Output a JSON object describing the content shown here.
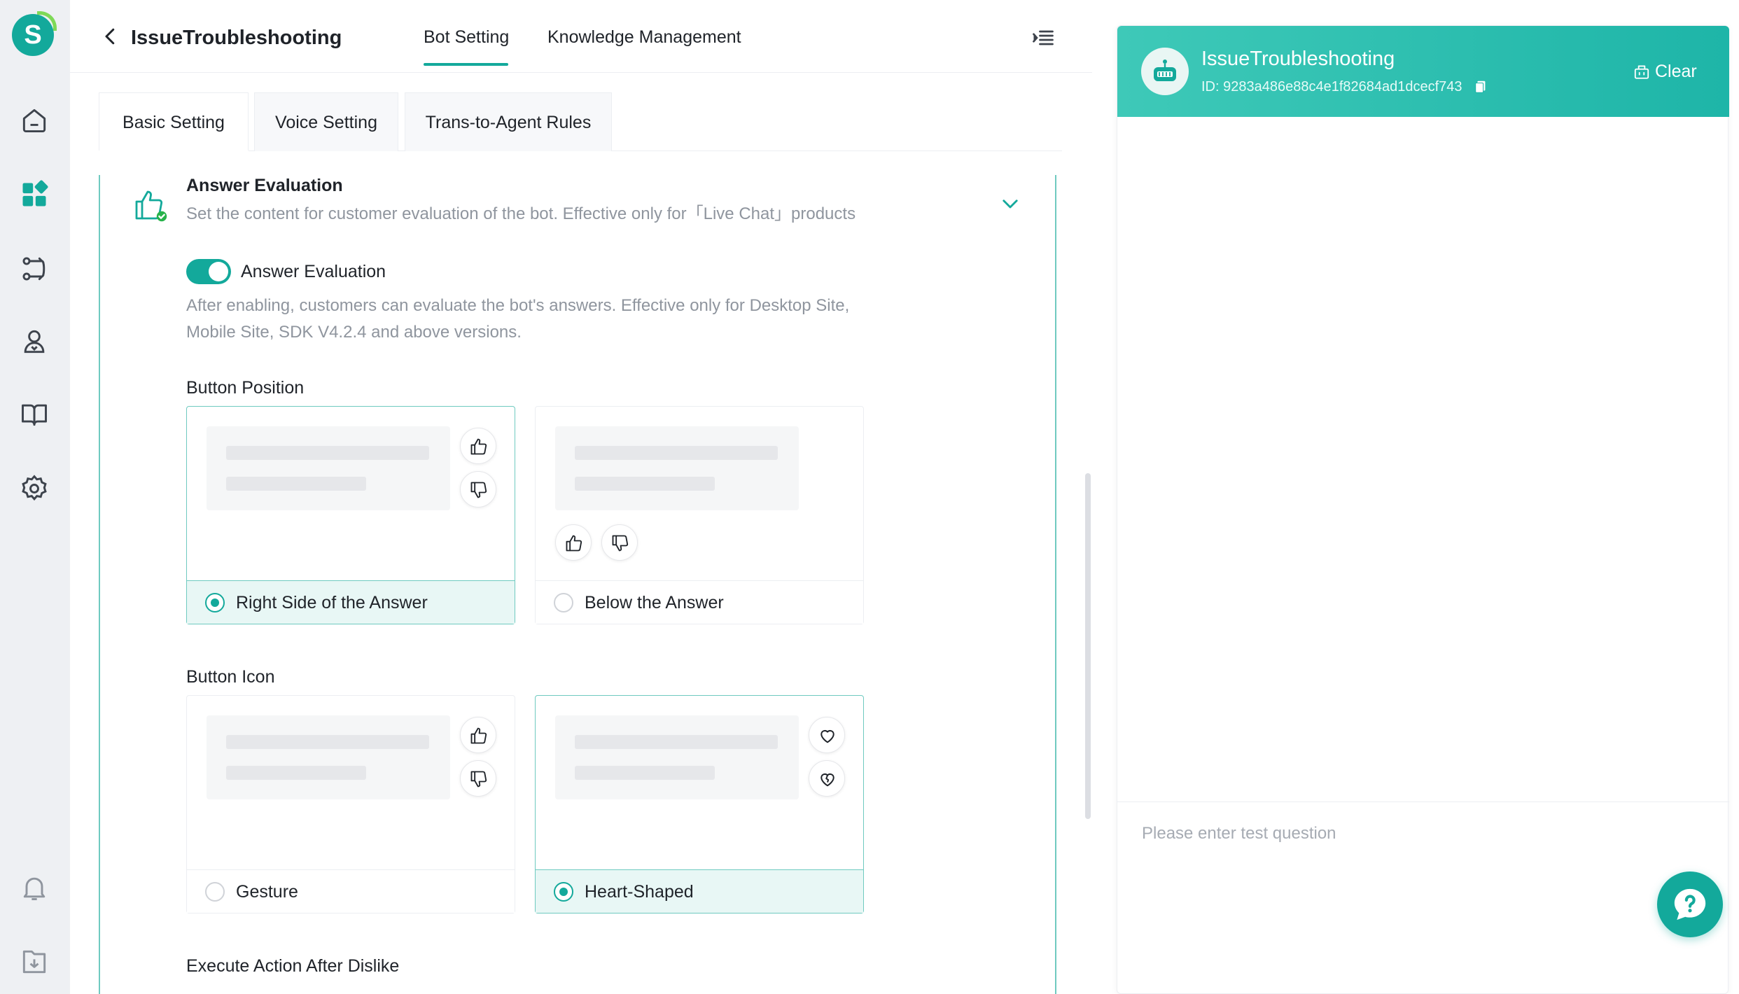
{
  "header": {
    "bot_name": "IssueTroubleshooting",
    "tabs": [
      {
        "label": "Bot Setting",
        "active": true
      },
      {
        "label": "Knowledge Management",
        "active": false
      }
    ]
  },
  "sidebar": {
    "logo_letter": "S",
    "items": [
      {
        "icon": "home-icon"
      },
      {
        "icon": "dashboard-icon",
        "active": true
      },
      {
        "icon": "routing-icon"
      },
      {
        "icon": "agent-icon"
      },
      {
        "icon": "book-icon"
      },
      {
        "icon": "gear-icon"
      }
    ],
    "bottom_items": [
      {
        "icon": "bell-icon"
      },
      {
        "icon": "download-icon"
      }
    ]
  },
  "subtabs": [
    {
      "label": "Basic Setting",
      "active": true
    },
    {
      "label": "Voice Setting",
      "active": false
    },
    {
      "label": "Trans-to-Agent Rules",
      "active": false
    }
  ],
  "answer_evaluation": {
    "title": "Answer Evaluation",
    "description": "Set the content for customer evaluation of the bot. Effective only for「Live Chat」products",
    "toggle_label": "Answer Evaluation",
    "toggle_on": true,
    "help_text": "After enabling, customers can evaluate the bot's answers. Effective only for Desktop Site, Mobile Site, SDK V4.2.4 and above versions.",
    "button_position": {
      "label": "Button Position",
      "options": [
        {
          "label": "Right Side of the Answer",
          "selected": true
        },
        {
          "label": "Below the Answer",
          "selected": false
        }
      ]
    },
    "button_icon": {
      "label": "Button Icon",
      "options": [
        {
          "label": "Gesture",
          "selected": false
        },
        {
          "label": "Heart-Shaped",
          "selected": true
        }
      ]
    },
    "execute_action_label": "Execute Action After Dislike"
  },
  "chat_panel": {
    "bot_name": "IssueTroubleshooting",
    "bot_id": "ID: 9283a486e88c4e1f82684ad1dcecf743",
    "clear_label": "Clear",
    "input_placeholder": "Please enter test question"
  },
  "colors": {
    "accent": "#13a99b",
    "header_gradient_start": "#3ec9b8",
    "header_gradient_end": "#1eb5a8",
    "muted_text": "#8f959e"
  }
}
